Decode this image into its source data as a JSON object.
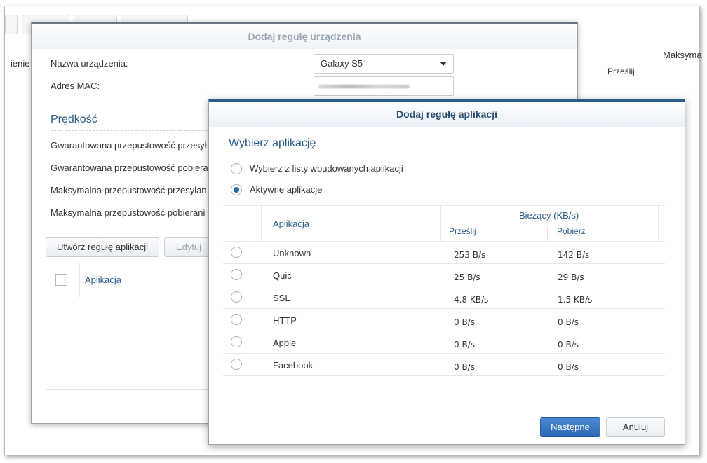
{
  "background": {
    "column_left_fragment": "ienie",
    "column_max": "Maksyma",
    "column_send": "Prześlij"
  },
  "device_dialog": {
    "title": "Dodaj regułę urządzenia",
    "device_name_label": "Nazwa urządzenia:",
    "device_name_value": "Galaxy S5",
    "mac_label": "Adres MAC:",
    "speed_section": "Prędkość",
    "fields": [
      "Gwarantowana przepustowość przesył",
      "Gwarantowana przepustowość pobiera",
      "Maksymalna przepustowość przesylan",
      "Maksymalna przepustowość pobierani"
    ],
    "create_rule_button": "Utwórz regułę aplikacji",
    "edit_button": "Edytuj",
    "table_header_app": "Aplikacja"
  },
  "app_dialog": {
    "title": "Dodaj regułę aplikacji",
    "section": "Wybierz aplikację",
    "options": [
      {
        "label": "Wybierz z listy wbudowanych aplikacji",
        "selected": false
      },
      {
        "label": "Aktywne aplikacje",
        "selected": true
      }
    ],
    "table": {
      "col_app": "Aplikacja",
      "col_current": "Bieżący (KB/s)",
      "col_upload": "Prześlij",
      "col_download": "Pobierz",
      "rows": [
        {
          "app": "Unknown",
          "upload": "253 B/s",
          "download": "142 B/s"
        },
        {
          "app": "Quic",
          "upload": "25 B/s",
          "download": "29 B/s"
        },
        {
          "app": "SSL",
          "upload": "4.8 KB/s",
          "download": "1.5 KB/s"
        },
        {
          "app": "HTTP",
          "upload": "0 B/s",
          "download": "0 B/s"
        },
        {
          "app": "Apple",
          "upload": "0 B/s",
          "download": "0 B/s"
        },
        {
          "app": "Facebook",
          "upload": "0 B/s",
          "download": "0 B/s"
        }
      ]
    },
    "next_button": "Następne",
    "cancel_button": "Anuluj"
  },
  "colors": {
    "accent": "#2d68b4",
    "section_text": "#2a5c8a",
    "header_bar": "#2d5b8e"
  }
}
